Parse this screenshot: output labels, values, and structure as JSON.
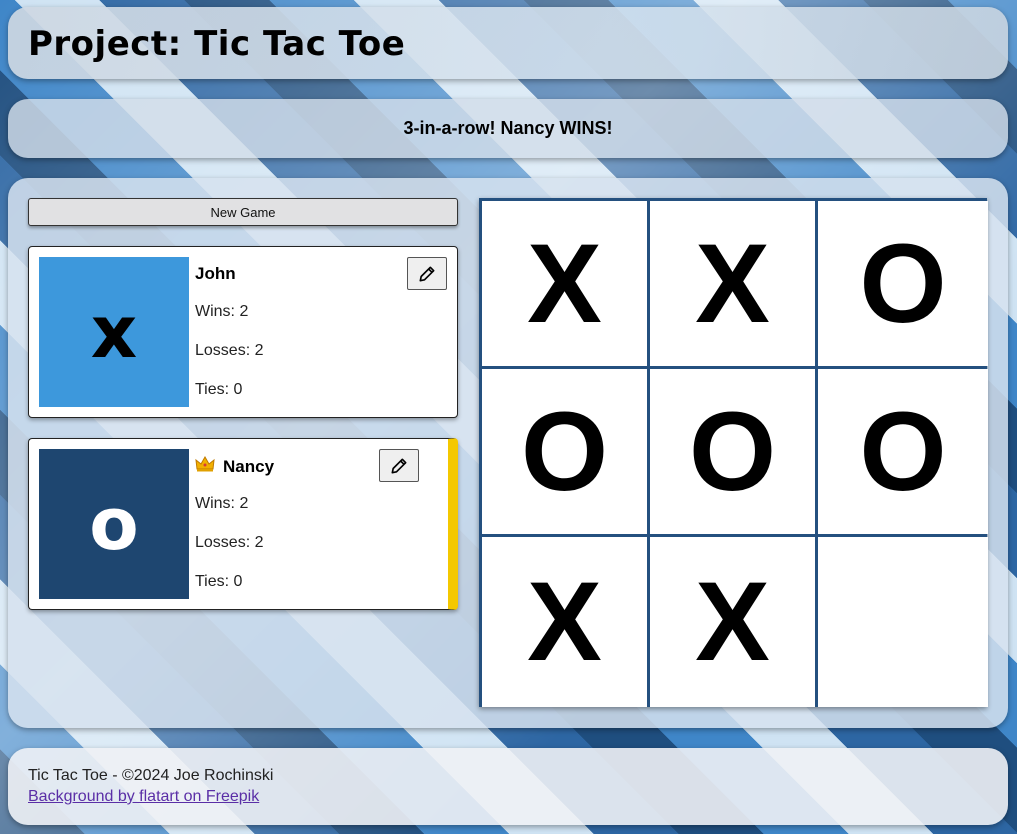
{
  "header": {
    "title": "Project: Tic Tac Toe"
  },
  "status": {
    "message": "3-in-a-row! Nancy WINS!"
  },
  "controls": {
    "new_game_label": "New Game"
  },
  "players": [
    {
      "name": "John",
      "marker": "x",
      "wins": "Wins: 2",
      "losses": "Losses: 2",
      "ties": "Ties: 0",
      "marker_bg": "#3d98dc",
      "marker_color": "#000000",
      "is_winner": false
    },
    {
      "name": "Nancy",
      "marker": "o",
      "wins": "Wins: 2",
      "losses": "Losses: 2",
      "ties": "Ties: 0",
      "marker_bg": "#1e4670",
      "marker_color": "#ffffff",
      "is_winner": true,
      "winner_icon": "crown-icon",
      "highlight_color": "#f4c800"
    }
  ],
  "board": {
    "cells": [
      "X",
      "X",
      "O",
      "O",
      "O",
      "O",
      "X",
      "X",
      ""
    ],
    "grid_color": "#24507f"
  },
  "footer": {
    "credit": "Tic Tac Toe - ©2024 Joe Rochinski",
    "link_text": "Background by flatart on Freepik"
  }
}
